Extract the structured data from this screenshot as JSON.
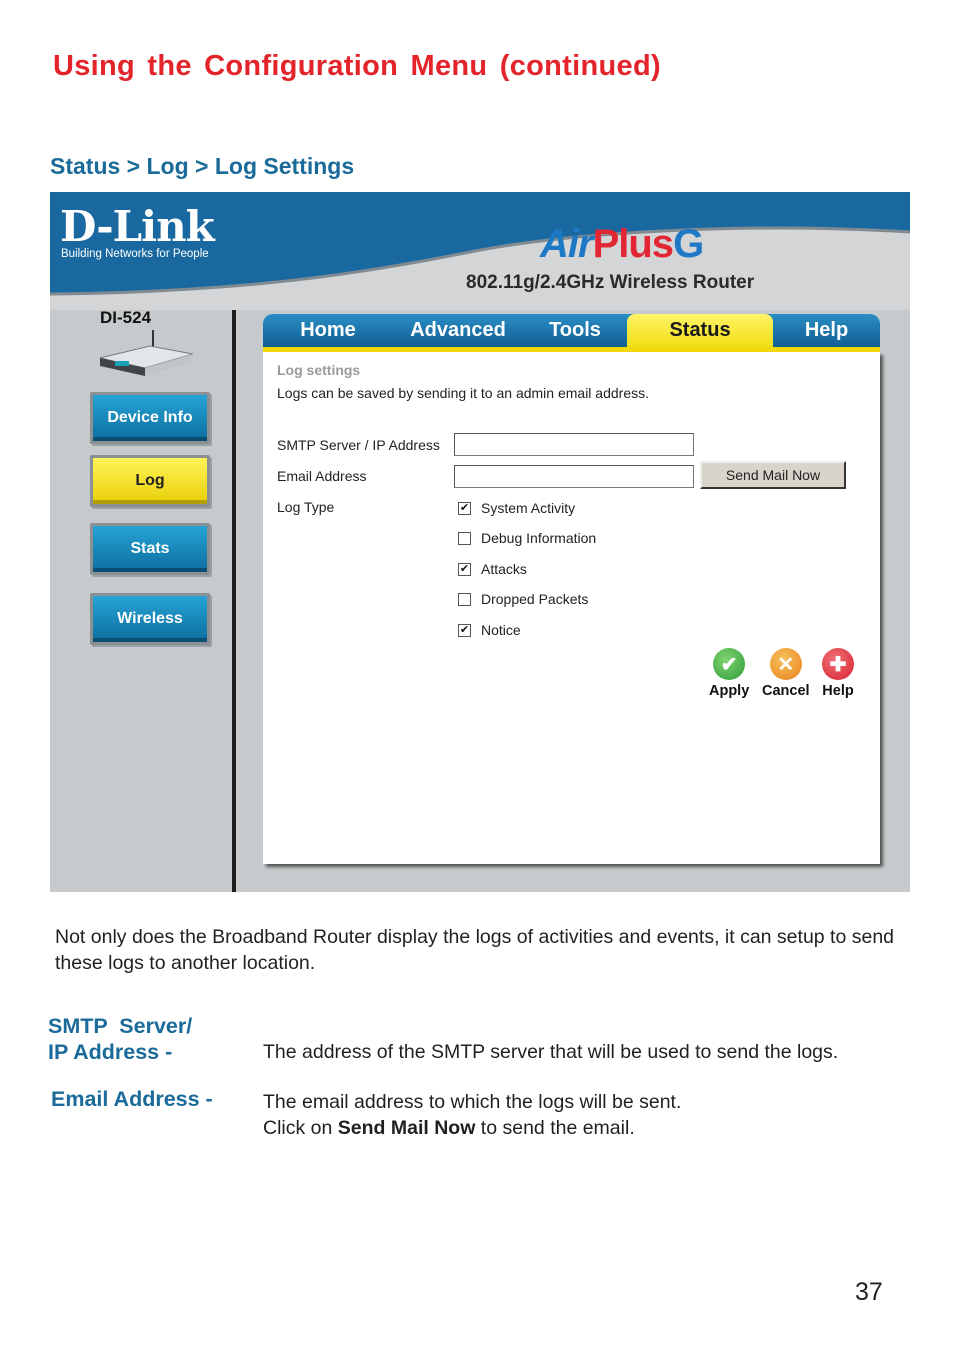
{
  "doc": {
    "title": "Using the Configuration Menu (continued)",
    "section_heading": "Status > Log > Log Settings",
    "page_number": "37"
  },
  "router_ui": {
    "brand": {
      "logo_text": "D-Link",
      "tagline": "Building Networks for People",
      "product_air": "Air",
      "product_plus": "Plus",
      "product_g": "G",
      "product_subtitle": "802.11g/2.4GHz Wireless Router",
      "model": "DI-524"
    },
    "side_nav": [
      {
        "label": "Device Info",
        "active": false
      },
      {
        "label": "Log",
        "active": true
      },
      {
        "label": "Stats",
        "active": false
      },
      {
        "label": "Wireless",
        "active": false
      }
    ],
    "tabs": [
      {
        "label": "Home",
        "active": false
      },
      {
        "label": "Advanced",
        "active": false
      },
      {
        "label": "Tools",
        "active": false
      },
      {
        "label": "Status",
        "active": true
      },
      {
        "label": "Help",
        "active": false
      }
    ],
    "panel": {
      "title": "Log settings",
      "description": "Logs can be saved by sending it to an admin email address.",
      "smtp_label": "SMTP Server / IP Address",
      "smtp_value": "",
      "email_label": "Email Address",
      "email_value": "",
      "send_button": "Send Mail Now",
      "log_type_label": "Log Type",
      "log_types": [
        {
          "label": "System Activity",
          "checked": true
        },
        {
          "label": "Debug Information",
          "checked": false
        },
        {
          "label": "Attacks",
          "checked": true
        },
        {
          "label": "Dropped Packets",
          "checked": false
        },
        {
          "label": "Notice",
          "checked": true
        }
      ],
      "actions": {
        "apply": "Apply",
        "cancel": "Cancel",
        "help": "Help"
      }
    },
    "colors": {
      "tab_blue": "#1a78b4",
      "active_yellow": "#f2dc16",
      "apply_green": "#2e9e3a",
      "cancel_orange": "#e8801f",
      "help_red": "#d8202e"
    }
  },
  "explanation": {
    "intro": "Not only does the Broadband Router display the logs of activities and events, it can setup to send these logs to another location.",
    "terms": [
      {
        "term_line1": "SMTP  Server/",
        "term_line2": "IP Address -",
        "definition": "The address of the SMTP server that will be used to send the logs."
      },
      {
        "term": "Email Address -",
        "definition_line1": "The email address to which the logs will be sent.",
        "definition_prefix": "Click on ",
        "definition_bold": "Send Mail Now",
        "definition_suffix": " to send the email."
      }
    ]
  }
}
